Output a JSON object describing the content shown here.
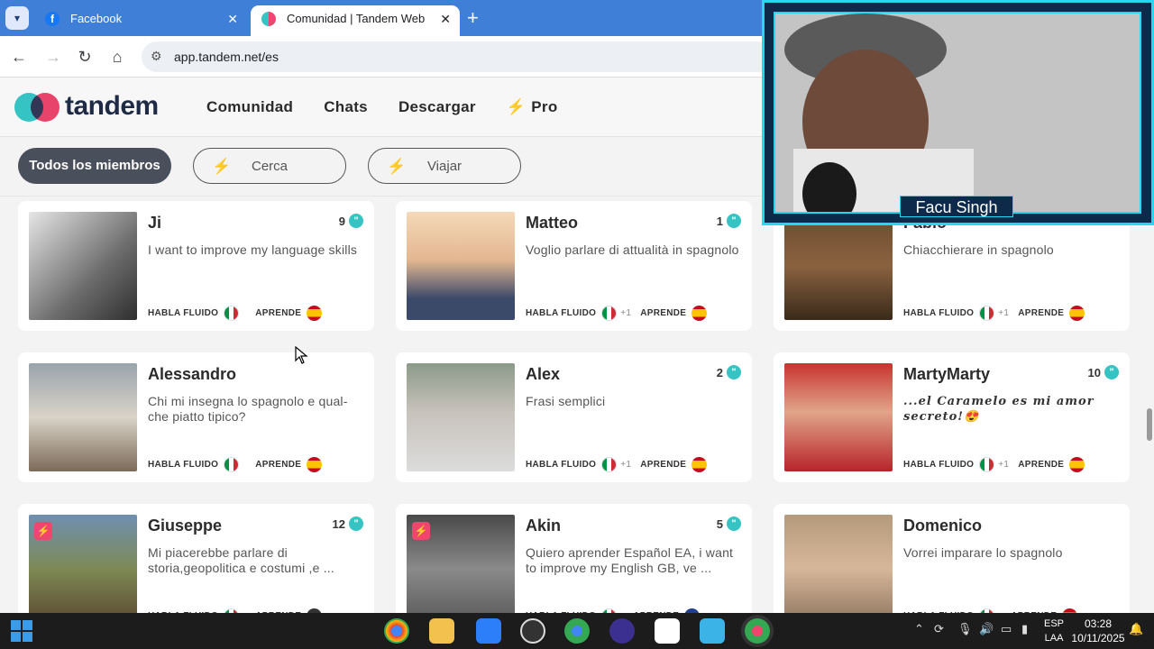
{
  "browser": {
    "tabs": [
      {
        "title": "Facebook",
        "active": false
      },
      {
        "title": "Comunidad | Tandem Web",
        "active": true
      }
    ],
    "url": "app.tandem.net/es"
  },
  "site": {
    "logo_text": "tandem",
    "nav": [
      "Comunidad",
      "Chats",
      "Descargar",
      "Pro"
    ]
  },
  "filters": {
    "all": "Todos los miembros",
    "near": "Cerca",
    "travel": "Viajar"
  },
  "labels": {
    "speaks": "HABLA FLUIDO",
    "learns": "APRENDE"
  },
  "members": [
    {
      "name": "Ji",
      "refs": "9",
      "bio": "I want to improve my language skills",
      "extra": "",
      "pro": false
    },
    {
      "name": "Matteo",
      "refs": "1",
      "bio": "Voglio parlare di attualità in spagnolo",
      "extra": "+1",
      "pro": false
    },
    {
      "name": "Fabio",
      "refs": "",
      "bio": "Chiacchierare in spagnolo",
      "extra": "+1",
      "pro": false
    },
    {
      "name": "Alessandro",
      "refs": "",
      "bio": "Chi mi insegna lo spagnolo e qual-che piatto tipico?",
      "extra": "",
      "pro": false
    },
    {
      "name": "Alex",
      "refs": "2",
      "bio": "Frasi semplici",
      "extra": "+1",
      "pro": false
    },
    {
      "name": "MartyMarty",
      "refs": "10",
      "bio": "...el Caramelo es mi amor secreto!😍",
      "extra": "+1",
      "pro": false
    },
    {
      "name": "Giuseppe",
      "refs": "12",
      "bio": "Mi piacerebbe parlare di storia,geopolitica e costumi ,e ...",
      "extra": "",
      "pro": true
    },
    {
      "name": "Akin",
      "refs": "5",
      "bio": "Quiero aprender Español EA, i want to improve my English GB, ve ...",
      "extra": "",
      "pro": true
    },
    {
      "name": "Domenico",
      "refs": "",
      "bio": "Vorrei imparare lo spagnolo",
      "extra": "",
      "pro": false
    }
  ],
  "overlay": {
    "streamer_name": "Facu Singh"
  },
  "taskbar": {
    "lang_top": "ESP",
    "lang_bottom": "LAA",
    "time": "03:28",
    "date": "10/11/2025"
  },
  "colors": {
    "tabbar": "#3f7fd8",
    "brand_teal": "#36c3c4",
    "brand_pink": "#f0466e",
    "pill_active": "#4a4f5c"
  }
}
